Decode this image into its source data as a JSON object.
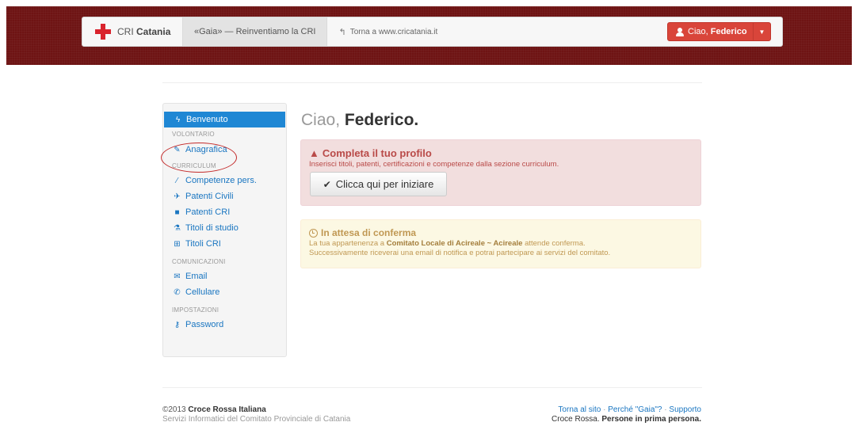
{
  "header": {
    "brand_normal": "CRI",
    "brand_bold": "Catania",
    "active_tab": "«Gaia» — Reinventiamo la CRI",
    "back_link": "Torna a www.cricatania.it",
    "user_greeting": "Ciao,",
    "user_name": "Federico",
    "brand_color": "#d9232d",
    "band_color": "#6e1414",
    "user_button_color": "#d9453a"
  },
  "sidebar": {
    "active": "Benvenuto",
    "sections": {
      "volontario": "VOLONTARIO",
      "curriculum": "CURRICULUM",
      "comunicazioni": "COMUNICAZIONI",
      "impostazioni": "IMPOSTAZIONI"
    },
    "items": {
      "anagrafica": "Anagrafica",
      "competenze": "Competenze pers.",
      "patenti_civili": "Patenti Civili",
      "patenti_cri": "Patenti CRI",
      "titoli_studio": "Titoli di studio",
      "titoli_cri": "Titoli CRI",
      "email": "Email",
      "cellulare": "Cellulare",
      "password": "Password"
    },
    "icons": {
      "benvenuto": "bolt-icon",
      "anagrafica": "edit-icon",
      "competenze": "magic-wand-icon",
      "patenti_civili": "airplane-icon",
      "patenti_cri": "ambulance-icon",
      "titoli_studio": "flask-icon",
      "titoli_cri": "plus-square-icon",
      "email": "envelope-icon",
      "cellulare": "phone-icon",
      "password": "key-icon"
    }
  },
  "main": {
    "title_light": "Ciao,",
    "title_bold": "Federico.",
    "profile_alert": {
      "heading": "Completa il tuo profilo",
      "text": "Inserisci titoli, patenti, certificazioni e competenze dalla sezione curriculum.",
      "button": "Clicca qui per iniziare"
    },
    "pending_alert": {
      "heading": "In attesa di conferma",
      "line1_prefix": "La tua appartenenza a",
      "line1_bold": "Comitato Locale di Acireale ~ Acireale",
      "line1_suffix": "attende conferma.",
      "line2": "Successivamente riceverai una email di notifica e potrai partecipare ai servizi del comitato."
    }
  },
  "footer": {
    "copyright_prefix": "©2013",
    "org": "Croce Rossa Italiana",
    "subtitle": "Servizi Informatici del Comitato Provinciale di Catania",
    "link_site": "Torna al sito",
    "link_gaia": "Perché \"Gaia\"?",
    "link_support": "Supporto",
    "separator": "·",
    "motto_prefix": "Croce Rossa.",
    "motto_bold": "Persone in prima persona."
  }
}
